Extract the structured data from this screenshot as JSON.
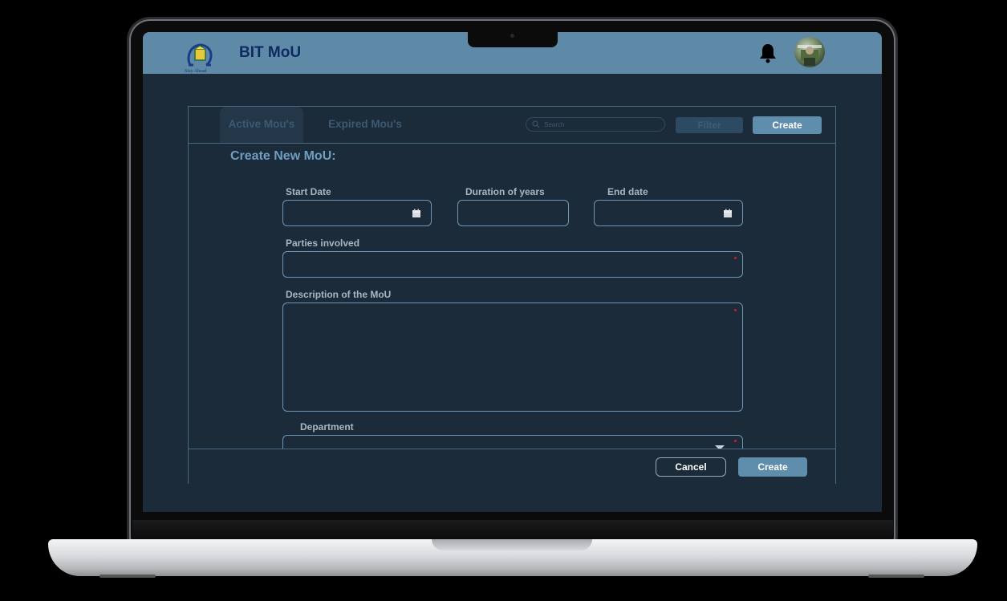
{
  "app": {
    "title": "BIT MoU",
    "logo_tagline": "Stay Ahead"
  },
  "tabs": [
    {
      "label": "Active Mou's",
      "active": true
    },
    {
      "label": "Expired Mou's",
      "active": false
    }
  ],
  "search": {
    "placeholder": "Search"
  },
  "toolbar": {
    "filter_label": "Filter",
    "create_label": "Create"
  },
  "form": {
    "title": "Create New MoU:",
    "start_date": {
      "label": "Start Date",
      "value": ""
    },
    "duration": {
      "label": "Duration of years",
      "value": ""
    },
    "end_date": {
      "label": "End date",
      "value": ""
    },
    "parties": {
      "label": "Parties involved",
      "value": ""
    },
    "description": {
      "label": "Description of the MoU",
      "value": ""
    },
    "department": {
      "label": "Department",
      "value": ""
    }
  },
  "footer": {
    "cancel_label": "Cancel",
    "create_label": "Create"
  },
  "colors": {
    "header_bg": "#5e8aa8",
    "screen_bg": "#1b2b3a",
    "accent": "#5f8eac",
    "title_text": "#6f9ec0",
    "required": "#cc2222"
  }
}
